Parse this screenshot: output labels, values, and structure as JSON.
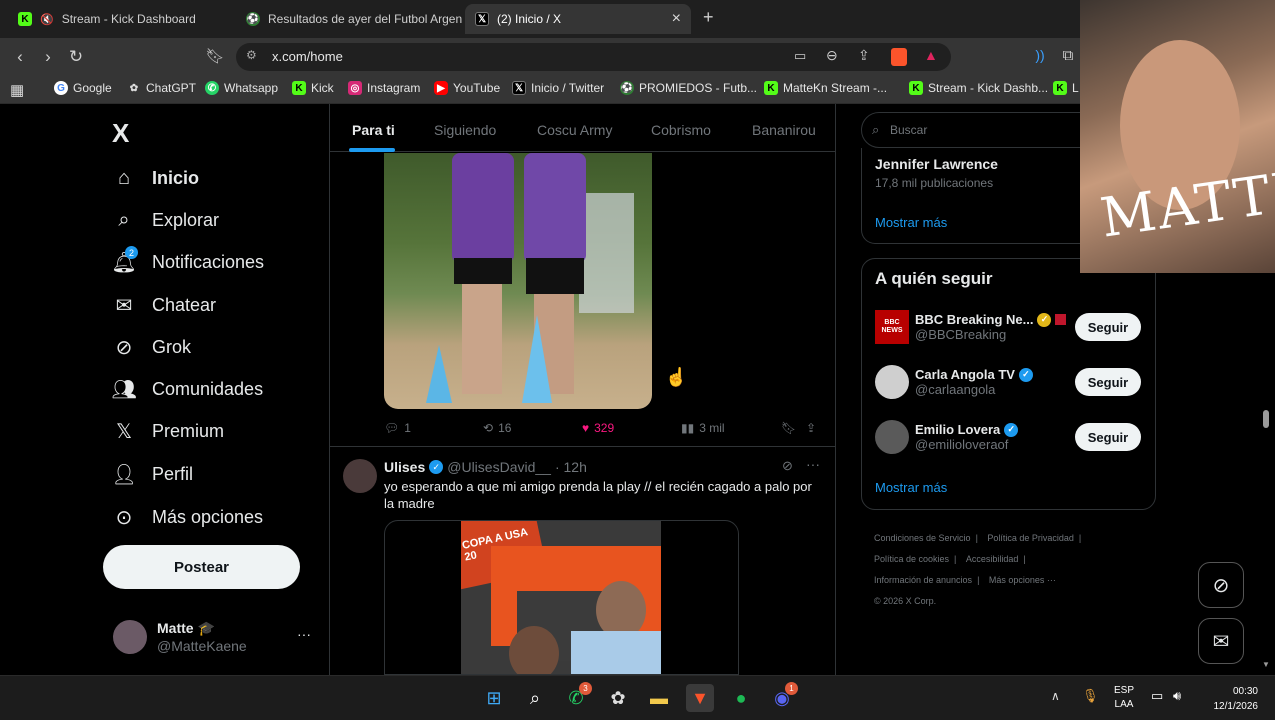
{
  "browser": {
    "tabs": [
      {
        "title": "Stream - Kick Dashboard",
        "icon": "kick-icon"
      },
      {
        "title": "Resultados de ayer del Futbol Argent",
        "icon": "promiedos-icon"
      },
      {
        "title": "(2) Inicio / X",
        "icon": "x-icon"
      }
    ],
    "new_tab": "+",
    "close_tab": "×",
    "url": "x.com/home",
    "bookmarks": [
      {
        "label": "Google",
        "icon": "google-icon"
      },
      {
        "label": "ChatGPT",
        "icon": "chatgpt-icon"
      },
      {
        "label": "Whatsapp",
        "icon": "whatsapp-icon"
      },
      {
        "label": "Kick",
        "icon": "kick-icon"
      },
      {
        "label": "Instagram",
        "icon": "instagram-icon"
      },
      {
        "label": "YouTube",
        "icon": "youtube-icon"
      },
      {
        "label": "Inicio / Twitter",
        "icon": "x-icon"
      },
      {
        "label": "PROMIEDOS - Futb...",
        "icon": "promiedos-icon"
      },
      {
        "label": "MatteKn Stream -...",
        "icon": "kick-icon"
      },
      {
        "label": "Stream - Kick Dashb...",
        "icon": "kick-icon"
      },
      {
        "label": "L",
        "icon": "kick-icon"
      }
    ]
  },
  "sidebar": {
    "logo": "X",
    "items": [
      {
        "label": "Inicio",
        "icon": "home-icon"
      },
      {
        "label": "Explorar",
        "icon": "search-icon"
      },
      {
        "label": "Notificaciones",
        "icon": "bell-icon",
        "badge": "2"
      },
      {
        "label": "Chatear",
        "icon": "mail-icon"
      },
      {
        "label": "Grok",
        "icon": "grok-icon"
      },
      {
        "label": "Comunidades",
        "icon": "communities-icon"
      },
      {
        "label": "Premium",
        "icon": "x-icon"
      },
      {
        "label": "Perfil",
        "icon": "person-icon"
      },
      {
        "label": "Más opciones",
        "icon": "more-circle-icon"
      }
    ],
    "post_button": "Postear",
    "account": {
      "name": "Matte 🎓",
      "handle": "@MatteKaene",
      "more": "···"
    }
  },
  "feed": {
    "tabs": [
      "Para ti",
      "Siguiendo",
      "Coscu Army",
      "Cobrismo",
      "Bananirou"
    ],
    "post1": {
      "replies": "1",
      "reposts": "16",
      "likes": "329",
      "views": "3 mil"
    },
    "post2": {
      "name": "Ulises",
      "handle": "@UlisesDavid__",
      "time": "· 12h",
      "text": "yo esperando a que mi amigo prenda la play // el recién cagado a palo por la madre",
      "image_text": "COPA A USA 20"
    }
  },
  "right": {
    "search_placeholder": "Buscar",
    "trend": {
      "name": "Jennifer Lawrence",
      "count": "17,8 mil publicaciones"
    },
    "show_more": "Mostrar más",
    "who_to_follow": {
      "title": "A quién seguir",
      "accounts": [
        {
          "name": "BBC Breaking Ne...",
          "handle": "@BBCBreaking",
          "button": "Seguir"
        },
        {
          "name": "Carla Angola TV",
          "handle": "@carlaangola",
          "button": "Seguir"
        },
        {
          "name": "Emilio Lovera",
          "handle": "@emilioloveraof",
          "button": "Seguir"
        }
      ],
      "show_more": "Mostrar más"
    },
    "footer": {
      "links": [
        "Condiciones de Servicio",
        "Política de Privacidad",
        "Política de cookies",
        "Accesibilidad",
        "Información de anuncios",
        "Más opciones ···"
      ],
      "copyright": "© 2026 X Corp."
    }
  },
  "overlay": {
    "text": "MATTE"
  },
  "taskbar": {
    "lang_top": "ESP",
    "lang_bottom": "LAA",
    "time": "00:30",
    "date": "12/1/2026",
    "whatsapp_badge": "3",
    "discord_badge": "1"
  },
  "colors": {
    "accent": "#1d9bf0",
    "like": "#f91880",
    "kick": "#53fc18"
  }
}
